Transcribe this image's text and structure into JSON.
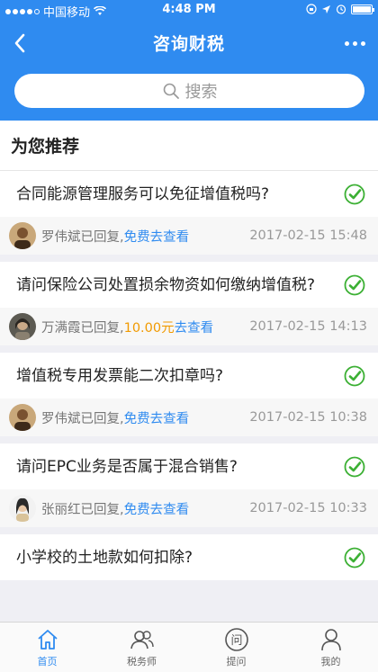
{
  "status_bar": {
    "carrier": "中国移动",
    "time": "4:48 PM"
  },
  "navbar": {
    "title": "咨询财税"
  },
  "search": {
    "placeholder": "搜索"
  },
  "section": {
    "title": "为您推荐"
  },
  "questions": [
    {
      "text": "合同能源管理服务可以免征增值税吗?",
      "replier": "罗伟斌已回复,",
      "price": "",
      "action": "免费去查看",
      "date": "2017-02-15 15:48",
      "avatar": "avatar-man"
    },
    {
      "text": "请问保险公司处置损余物资如何缴纳增值税?",
      "replier": "万满霞已回复,",
      "price": "10.00元",
      "action": "去查看",
      "date": "2017-02-15 14:13",
      "avatar": "avatar-woman"
    },
    {
      "text": "增值税专用发票能二次扣章吗?",
      "replier": "罗伟斌已回复,",
      "price": "",
      "action": "免费去查看",
      "date": "2017-02-15 10:38",
      "avatar": "avatar-man"
    },
    {
      "text": "请问EPC业务是否属于混合销售?",
      "replier": "张丽红已回复,",
      "price": "",
      "action": "免费去查看",
      "date": "2017-02-15 10:33",
      "avatar": "avatar-woman-2"
    },
    {
      "text": "小学校的土地款如何扣除?",
      "replier": "",
      "price": "",
      "action": "",
      "date": "",
      "avatar": ""
    }
  ],
  "tabbar": {
    "items": [
      {
        "label": "首页",
        "icon": "home-icon",
        "active": true
      },
      {
        "label": "税务师",
        "icon": "people-icon",
        "active": false
      },
      {
        "label": "提问",
        "icon": "ask-icon",
        "active": false
      },
      {
        "label": "我的",
        "icon": "user-icon",
        "active": false
      }
    ]
  },
  "colors": {
    "primary": "#2f8bf0",
    "check": "#3cb034",
    "price": "#f19a00"
  }
}
